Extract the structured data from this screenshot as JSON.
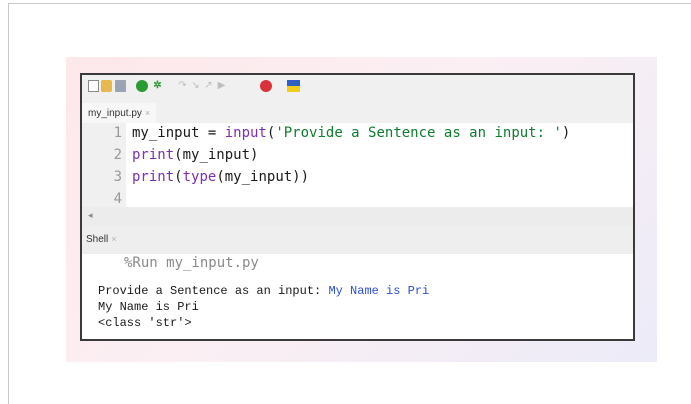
{
  "toolbar": {
    "icons": [
      "new-file-icon",
      "open-file-icon",
      "save-icon",
      "run-icon",
      "debug-icon",
      "step-over-icon",
      "step-into-icon",
      "step-out-icon",
      "resume-icon",
      "stop-icon",
      "flag-icon"
    ]
  },
  "editor": {
    "tab_label": "my_input.py",
    "tab_close": "×",
    "lines": [
      {
        "num": "1",
        "segments": [
          {
            "text": "my_input = ",
            "kind": "plain"
          },
          {
            "text": "input",
            "kind": "kw"
          },
          {
            "text": "(",
            "kind": "plain"
          },
          {
            "text": "'Provide a Sentence as an input: '",
            "kind": "str"
          },
          {
            "text": ")",
            "kind": "plain"
          }
        ]
      },
      {
        "num": "2",
        "segments": [
          {
            "text": "print",
            "kind": "kw"
          },
          {
            "text": "(my_input)",
            "kind": "plain"
          }
        ]
      },
      {
        "num": "3",
        "segments": [
          {
            "text": "print",
            "kind": "kw"
          },
          {
            "text": "(",
            "kind": "plain"
          },
          {
            "text": "type",
            "kind": "kw"
          },
          {
            "text": "(my_input))",
            "kind": "plain"
          }
        ]
      },
      {
        "num": "4",
        "segments": []
      }
    ],
    "scroll_arrow": "◂"
  },
  "shell": {
    "tab_label": "Shell",
    "tab_close": "×",
    "command": "%Run my_input.py",
    "prompt": "Provide a Sentence as an input: ",
    "user_input": "My Name is Pri",
    "output_lines": [
      "My Name is Pri",
      "<class 'str'>"
    ]
  }
}
